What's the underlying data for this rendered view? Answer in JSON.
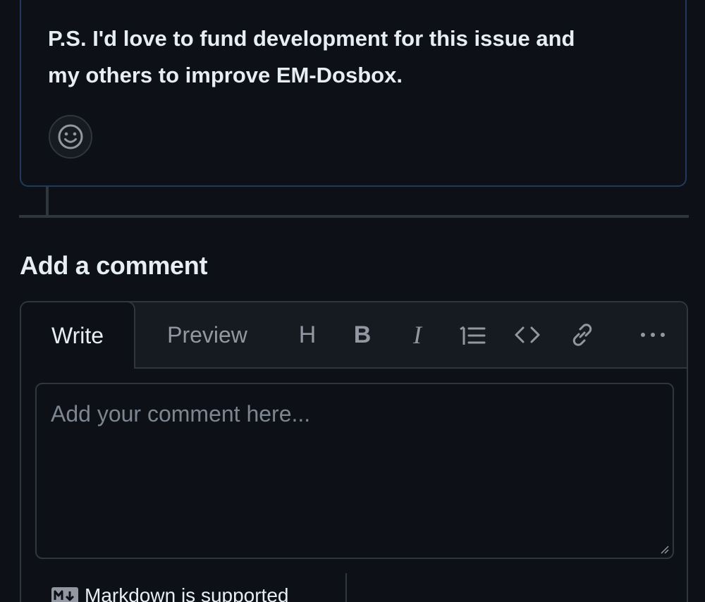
{
  "comment": {
    "body_lines": [
      "P.S. I'd love to fund development for this issue and",
      "my others to improve EM-Dosbox."
    ]
  },
  "add_comment": {
    "heading": "Add a comment",
    "tabs": {
      "write": "Write",
      "preview": "Preview"
    },
    "toolbar": [
      "heading-icon",
      "bold-icon",
      "italic-icon",
      "list-icon",
      "code-icon",
      "link-icon",
      "more-icon"
    ],
    "toolbar_glyphs": {
      "heading": "H",
      "bold": "B",
      "italic": "I"
    },
    "textarea": {
      "placeholder": "Add your comment here...",
      "value": ""
    },
    "markdown_hint": "Markdown is supported"
  },
  "colors": {
    "background": "#0d1117",
    "border": "#30363d",
    "header_bg": "#161b22",
    "text": "#e6edf3",
    "muted": "#9198a1",
    "card_border": "#1f3a5f"
  }
}
